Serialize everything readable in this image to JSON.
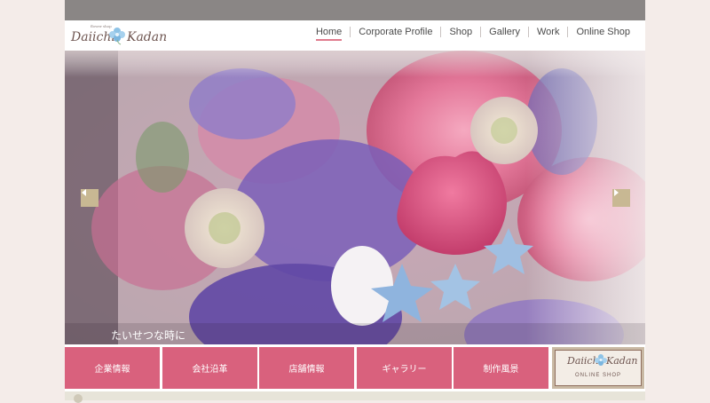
{
  "header": {
    "logo_small_text": "flower shop",
    "logo_word1": "Daiichi",
    "logo_word2": "Kadan"
  },
  "nav": {
    "items": [
      {
        "label": "Home",
        "active": true
      },
      {
        "label": "Corporate Profile",
        "active": false
      },
      {
        "label": "Shop",
        "active": false
      },
      {
        "label": "Gallery",
        "active": false
      },
      {
        "label": "Work",
        "active": false
      },
      {
        "label": "Online Shop",
        "active": false
      }
    ]
  },
  "slider": {
    "caption": "たいせつな時に",
    "prev_icon": "chevron-left-icon",
    "next_icon": "chevron-right-icon"
  },
  "buttons": [
    {
      "label": "企業情報"
    },
    {
      "label": "会社沿革"
    },
    {
      "label": "店舗情報"
    },
    {
      "label": "ギャラリー"
    },
    {
      "label": "制作風景"
    }
  ],
  "online_shop_banner": {
    "word1": "Daiichi",
    "word2": "Kadan",
    "subtitle": "ONLINE SHOP"
  },
  "colors": {
    "accent_pink": "#d9617d",
    "nav_underline": "#e07b8d",
    "topbar": "#8a8685",
    "arrow_bg": "#c8b893"
  }
}
